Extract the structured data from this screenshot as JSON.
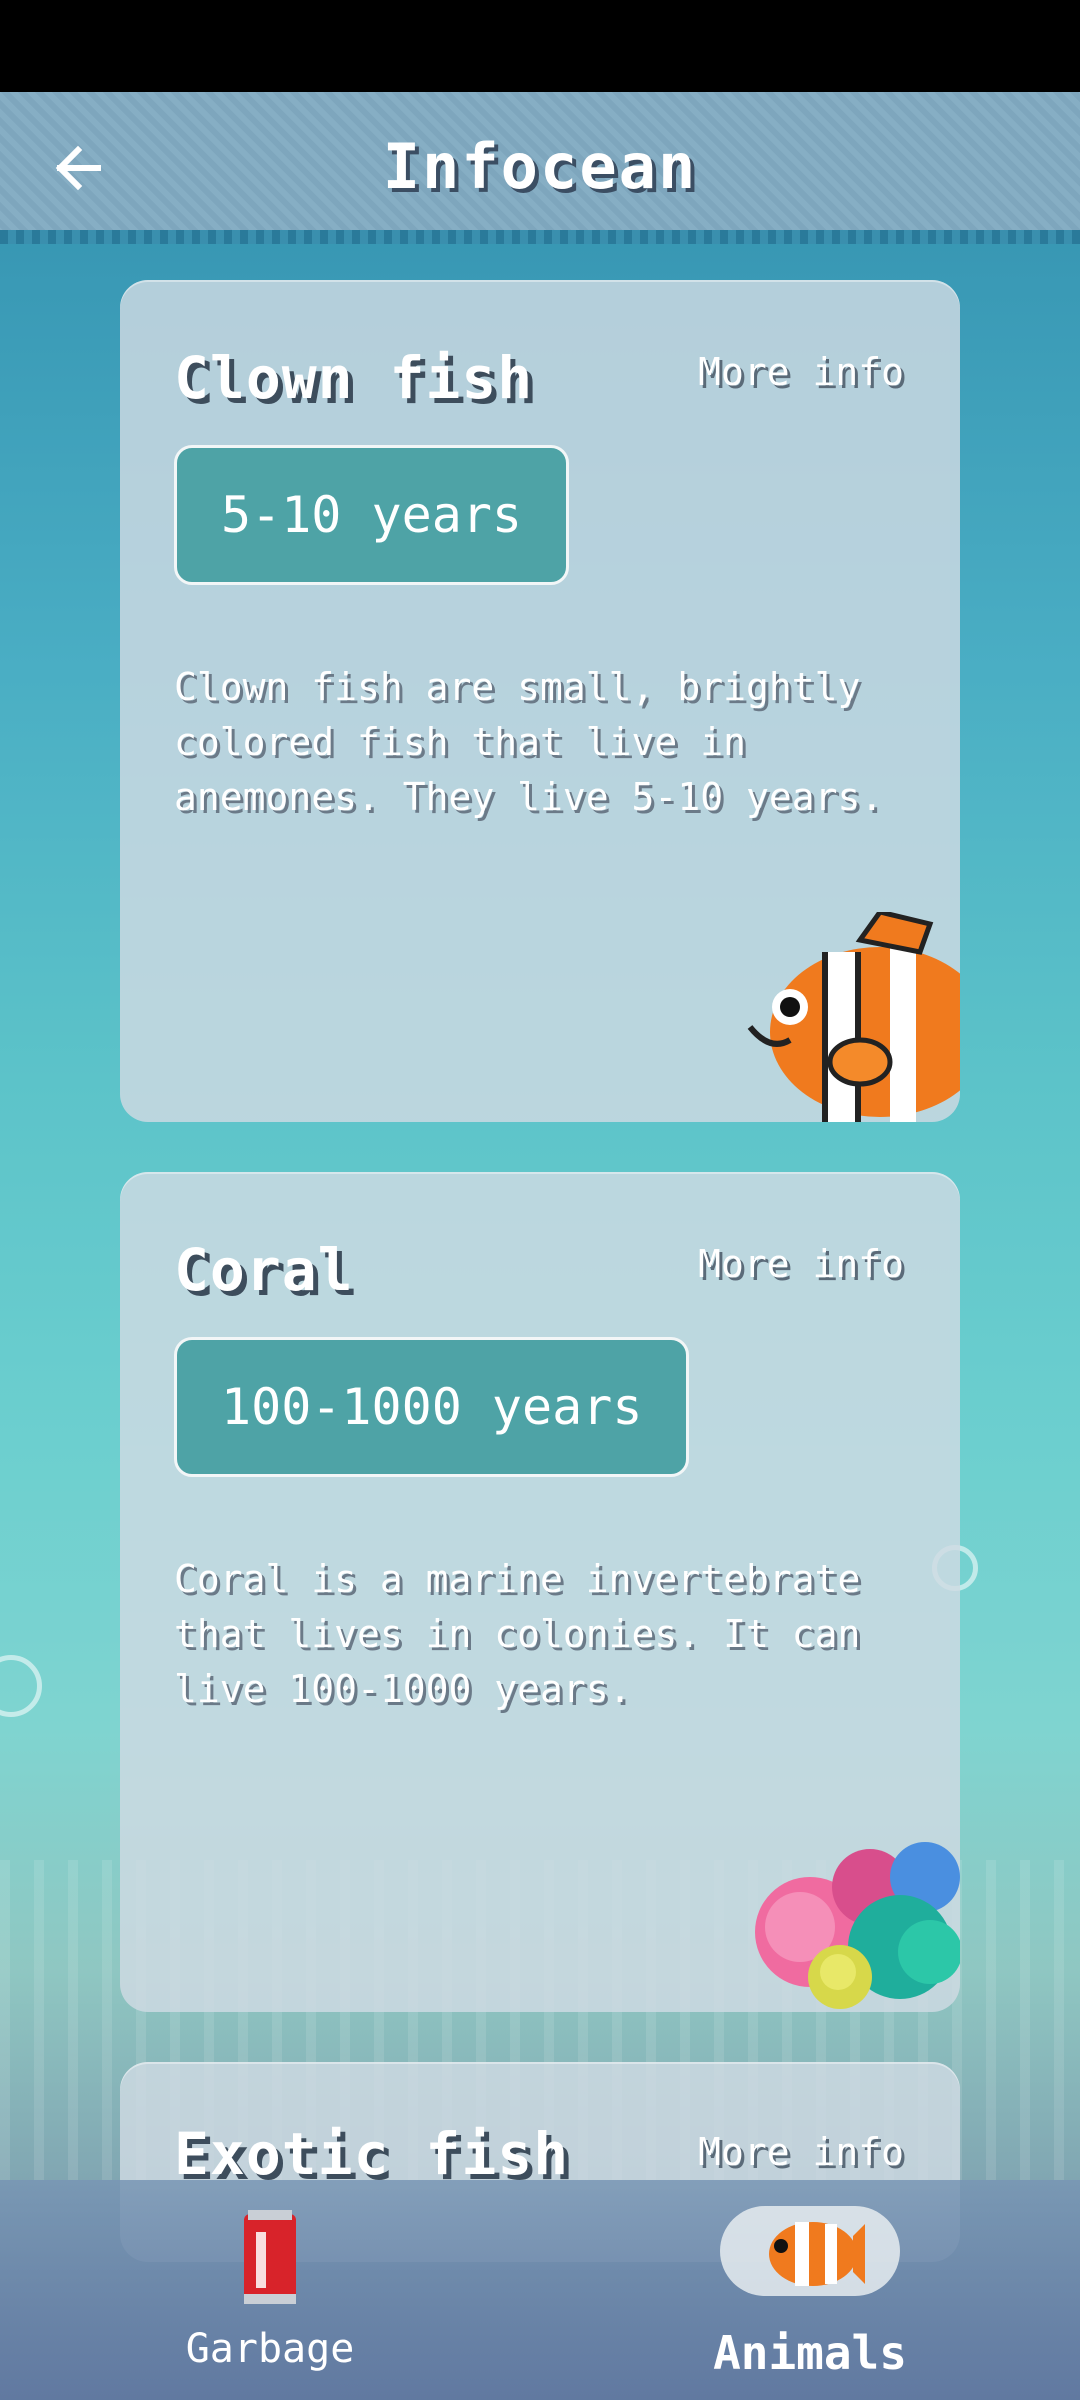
{
  "app": {
    "title": "Infocean"
  },
  "cards": [
    {
      "title": "Clown fish",
      "more_info": "More info",
      "lifespan": "5-10 years",
      "description": "Clown fish are small, brightly colored fish that live in anemones. They live 5-10 years.",
      "icon": "clownfish-icon"
    },
    {
      "title": "Coral",
      "more_info": "More info",
      "lifespan": "100-1000 years",
      "description": "Coral is a marine invertebrate that lives in colonies. It can live 100-1000 years.",
      "icon": "coral-icon"
    },
    {
      "title": "Exotic fish",
      "more_info": "More info"
    }
  ],
  "nav": {
    "items": [
      {
        "label": "Garbage",
        "icon": "soda-can-icon",
        "selected": false
      },
      {
        "label": "Animals",
        "icon": "clownfish-icon",
        "selected": true
      }
    ]
  },
  "colors": {
    "badge": "#4ea3a6",
    "card": "#d0dbe3",
    "title_shadow": "#3d4d5c"
  }
}
